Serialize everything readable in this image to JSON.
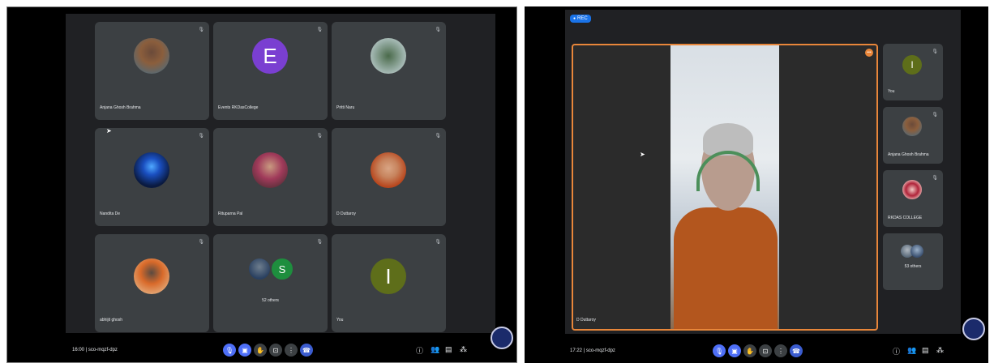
{
  "left": {
    "tiles": [
      {
        "name": "Anjana Ghosh Brahma"
      },
      {
        "name": "Events RKDasCollege",
        "initial": "E"
      },
      {
        "name": "Pritti Naru"
      },
      {
        "name": "Nandita De"
      },
      {
        "name": "Rituparna Pal"
      },
      {
        "name": "D Duttaroy"
      },
      {
        "name": "abhijit ghosh"
      },
      {
        "name": "52 others",
        "initial": "S"
      },
      {
        "name": "You",
        "initial": "I"
      }
    ],
    "time": "16:00",
    "meeting_code": "sco-mqzf-dpz"
  },
  "right": {
    "rec_label": "REC",
    "speaker_name": "D Duttaroy",
    "side_tiles": [
      {
        "name": "You",
        "initial": "I"
      },
      {
        "name": "Anjana Ghosh Brahma"
      },
      {
        "name": "RKDAS COLLEGE"
      },
      {
        "name": "53 others"
      }
    ],
    "time": "17:22",
    "meeting_code": "sco-mqzf-dpz"
  },
  "colors": {
    "accent": "#4e6ff7",
    "speaker_border": "#e8863a",
    "rec": "#1a73e8"
  },
  "icons": [
    "mic-off-icon",
    "camera-off-icon",
    "raise-hand-icon",
    "present-icon",
    "more-icon",
    "end-call-icon",
    "info-icon",
    "people-icon",
    "chat-icon",
    "activities-icon"
  ]
}
